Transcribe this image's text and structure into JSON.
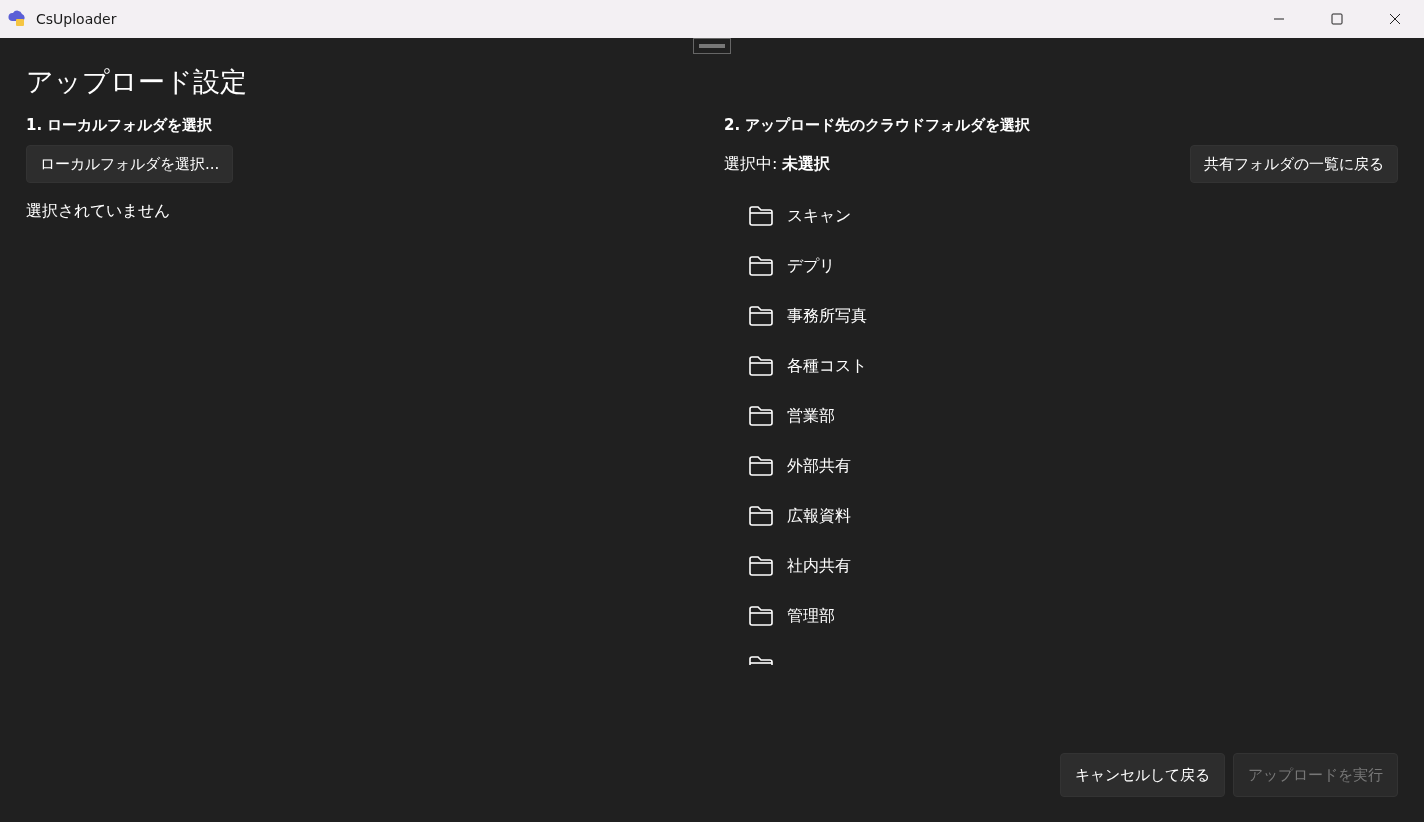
{
  "window": {
    "title": "CsUploader"
  },
  "page_title": "アップロード設定",
  "local": {
    "heading": "1. ローカルフォルダを選択",
    "button": "ローカルフォルダを選択...",
    "status": "選択されていません"
  },
  "cloud": {
    "heading": "2. アップロード先のクラウドフォルダを選択",
    "selection_label": "選択中: ",
    "selection_value": "未選択",
    "back_button": "共有フォルダの一覧に戻る",
    "folders": [
      {
        "name": "スキャン"
      },
      {
        "name": "デプリ"
      },
      {
        "name": "事務所写真"
      },
      {
        "name": "各種コスト"
      },
      {
        "name": "営業部"
      },
      {
        "name": "外部共有"
      },
      {
        "name": "広報資料"
      },
      {
        "name": "社内共有"
      },
      {
        "name": "管理部"
      }
    ],
    "more_below": true
  },
  "buttons": [
    {
      "label": "キャンセルして戻る",
      "disabled": false
    },
    {
      "label": "アップロードを実行",
      "disabled": true
    }
  ]
}
